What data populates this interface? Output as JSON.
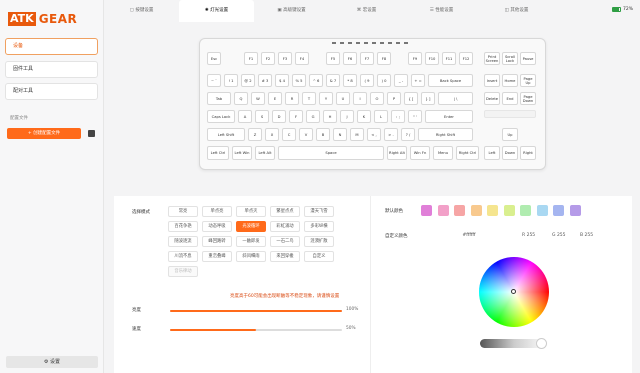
{
  "logo": {
    "atk": "ATK",
    "gear": "GEAR"
  },
  "sidebar": {
    "items": [
      {
        "label": "设备"
      },
      {
        "label": "固件工具"
      },
      {
        "label": "配对工具"
      }
    ],
    "config_section": "配置文件",
    "add_button": "+ 创建配置文件",
    "settings": "设置"
  },
  "tabs": [
    {
      "label": "按键设置"
    },
    {
      "label": "灯光设置"
    },
    {
      "label": "高级键设置"
    },
    {
      "label": "宏设置"
    },
    {
      "label": "性能设置"
    },
    {
      "label": "其他设置"
    }
  ],
  "battery": "72%",
  "keyboard": {
    "row0": [
      "Esc",
      "F1",
      "F2",
      "F3",
      "F4",
      "F5",
      "F6",
      "F7",
      "F8",
      "F9",
      "F10",
      "F11",
      "F12",
      "Print Screen",
      "Scroll Lock",
      "Pause"
    ],
    "row1": [
      "~ `",
      "! 1",
      "@ 2",
      "# 3",
      "$ 4",
      "% 5",
      "^ 6",
      "& 7",
      "* 8",
      "( 9",
      ") 0",
      "_ -",
      "+ =",
      "Back Space",
      "Insert",
      "Home",
      "Page Up"
    ],
    "row2": [
      "Tab",
      "Q",
      "W",
      "E",
      "R",
      "T",
      "Y",
      "U",
      "I",
      "O",
      "P",
      "{ [",
      "} ]",
      "| \\",
      "Delete",
      "End",
      "Page Down"
    ],
    "row3": [
      "Caps Lock",
      "A",
      "S",
      "D",
      "F",
      "G",
      "H",
      "J",
      "K",
      "L",
      ": ;",
      "\" '",
      "Enter"
    ],
    "row4": [
      "Left Shift",
      "Z",
      "X",
      "C",
      "V",
      "B",
      "N",
      "M",
      "< ,",
      "> .",
      "? /",
      "Right Shift",
      "Up"
    ],
    "row5": [
      "Left Ctrl",
      "Left Win",
      "Left Alt",
      "Space",
      "Right Alt",
      "Win Fn",
      "Menu",
      "Right Ctrl",
      "Left",
      "Down",
      "Right"
    ]
  },
  "lighting": {
    "mode_label": "选择模式",
    "modes": [
      "常亮",
      "单点亮",
      "单点灭",
      "繁星点点",
      "漫天飞雪",
      "百花争艳",
      "动态呼吸",
      "光波循环",
      "彩虹涌动",
      "多彩纵横",
      "随波逐流",
      "峰回路转",
      "一触即发",
      "一石二鸟",
      "涟漪扩散",
      "川流不息",
      "重峦叠嶂",
      "斜风细雨",
      "来回穿梭",
      "自定义",
      "音乐律动"
    ],
    "active_mode": "光波循环",
    "warning": "亮度高于60可能会出现断触等不稳定现象，请谨慎设置",
    "brightness_label": "亮度",
    "brightness": "100%",
    "brightness_value": 1.0,
    "speed_label": "速度",
    "speed": "50%",
    "speed_value": 0.5,
    "default_color_label": "默认颜色",
    "default_colors": [
      "#e07fd8",
      "#f2a0c8",
      "#f6a5a5",
      "#f8c98e",
      "#f5e58f",
      "#d9ef8f",
      "#b0ecb0",
      "#a9d8f2",
      "#a5b5f0",
      "#b59be8"
    ],
    "custom_color_label": "自定义颜色",
    "hex": "#ffffff",
    "r_label": "R",
    "r": "255",
    "g_label": "G",
    "g": "255",
    "b_label": "B",
    "b": "255"
  }
}
